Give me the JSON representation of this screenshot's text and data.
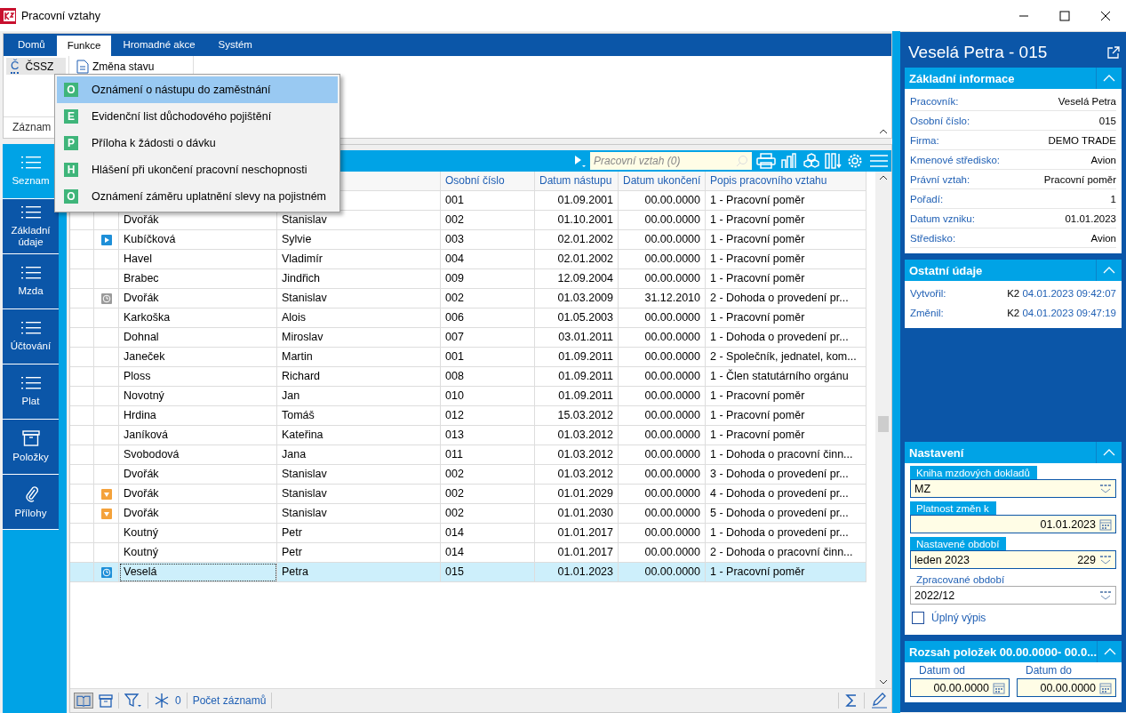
{
  "window": {
    "title": "Pracovní vztahy"
  },
  "ribbon": {
    "tabs": [
      {
        "label": "Domů",
        "selected": false
      },
      {
        "label": "Funkce",
        "selected": true
      },
      {
        "label": "Hromadné akce",
        "selected": false
      },
      {
        "label": "Systém",
        "selected": false
      }
    ],
    "buttons": [
      {
        "kind": "letter",
        "icon_letter": "Č",
        "label": "ČSSZ",
        "pressed": true
      },
      {
        "kind": "doc",
        "label": "Změna stavu",
        "pressed": false
      }
    ],
    "group_label": "Záznam"
  },
  "menu": {
    "items": [
      {
        "letter": "O",
        "label": "Oznámení o nástupu do zaměstnání",
        "selected": true
      },
      {
        "letter": "E",
        "label": "Evidenční list důchodového pojištění",
        "selected": false
      },
      {
        "letter": "P",
        "label": "Příloha k žádosti o dávku",
        "selected": false
      },
      {
        "letter": "H",
        "label": "Hlášení při ukončení pracovní neschopnosti",
        "selected": false
      },
      {
        "letter": "O",
        "label": "Oznámení záměru uplatnění slevy na pojistném",
        "selected": false
      }
    ]
  },
  "sidebar": {
    "items": [
      {
        "kind": "list",
        "label": "Seznam",
        "selected": true
      },
      {
        "kind": "list",
        "label": "Základní údaje",
        "selected": false
      },
      {
        "kind": "list",
        "label": "Mzda",
        "selected": false
      },
      {
        "kind": "list",
        "label": "Účtování",
        "selected": false
      },
      {
        "kind": "list",
        "label": "Plat",
        "selected": false
      },
      {
        "kind": "box",
        "label": "Položky",
        "selected": false
      },
      {
        "kind": "clip",
        "label": "Přílohy",
        "selected": false
      }
    ]
  },
  "table": {
    "search": {
      "placeholder": "Pracovní vztah (0)"
    },
    "columns": [
      "Osobní číslo",
      "Datum nástupu",
      "Datum ukončení",
      "Popis pracovního vztahu"
    ],
    "rows": [
      {
        "number": "001",
        "start": "01.09.2001",
        "end": "00.00.0000",
        "description": "1 - Pracovní poměr",
        "selected": false
      },
      {
        "surname": "Dvořák",
        "name": "Stanislav",
        "number": "002",
        "start": "01.10.2001",
        "end": "00.00.0000",
        "description": "1 - Pracovní poměr",
        "selected": false
      },
      {
        "kind": "play",
        "surname": "Kubíčková",
        "name": "Sylvie",
        "number": "003",
        "start": "02.01.2002",
        "end": "00.00.0000",
        "description": "1 - Pracovní poměr",
        "selected": false
      },
      {
        "surname": "Havel",
        "name": "Vladimír",
        "number": "004",
        "start": "02.01.2002",
        "end": "00.00.0000",
        "description": "1 - Pracovní poměr",
        "selected": false
      },
      {
        "surname": "Brabec",
        "name": "Jindřich",
        "number": "009",
        "start": "12.09.2004",
        "end": "00.00.0000",
        "description": "1 - Pracovní poměr",
        "selected": false
      },
      {
        "kind": "clock",
        "surname": "Dvořák",
        "name": "Stanislav",
        "number": "002",
        "start": "01.03.2009",
        "end": "31.12.2010",
        "description": "2 - Dohoda o provedení pr...",
        "selected": false
      },
      {
        "surname": "Karkoška",
        "name": "Alois",
        "number": "006",
        "start": "01.05.2003",
        "end": "00.00.0000",
        "description": "1 - Pracovní poměr",
        "selected": false
      },
      {
        "surname": "Dohnal",
        "name": "Miroslav",
        "number": "007",
        "start": "03.01.2011",
        "end": "00.00.0000",
        "description": "1 - Dohoda o provedení pr...",
        "selected": false
      },
      {
        "surname": "Janeček",
        "name": "Martin",
        "number": "001",
        "start": "01.09.2011",
        "end": "00.00.0000",
        "description": "2 - Společník, jednatel, kom...",
        "selected": false
      },
      {
        "surname": "Ploss",
        "name": "Richard",
        "number": "008",
        "start": "01.09.2011",
        "end": "00.00.0000",
        "description": "1 - Člen statutárního orgánu",
        "selected": false
      },
      {
        "surname": "Novotný",
        "name": "Jan",
        "number": "010",
        "start": "01.09.2011",
        "end": "00.00.0000",
        "description": "1 - Pracovní poměr",
        "selected": false
      },
      {
        "surname": "Hrdina",
        "name": "Tomáš",
        "number": "012",
        "start": "15.03.2012",
        "end": "00.00.0000",
        "description": "1 - Pracovní poměr",
        "selected": false
      },
      {
        "surname": "Janíková",
        "name": "Kateřina",
        "number": "013",
        "start": "01.03.2012",
        "end": "00.00.0000",
        "description": "1 - Pracovní poměr",
        "selected": false
      },
      {
        "surname": "Svobodová",
        "name": "Jana",
        "number": "011",
        "start": "01.03.2012",
        "end": "00.00.0000",
        "description": "1 - Dohoda o pracovní činn...",
        "selected": false
      },
      {
        "surname": "Dvořák",
        "name": "Stanislav",
        "number": "002",
        "start": "01.03.2012",
        "end": "00.00.0000",
        "description": "3 - Dohoda o provedení pr...",
        "selected": false
      },
      {
        "kind": "down",
        "surname": "Dvořák",
        "name": "Stanislav",
        "number": "002",
        "start": "01.01.2029",
        "end": "00.00.0000",
        "description": "4 - Dohoda o provedení pr...",
        "selected": false
      },
      {
        "kind": "down",
        "surname": "Dvořák",
        "name": "Stanislav",
        "number": "002",
        "start": "01.01.2030",
        "end": "00.00.0000",
        "description": "5 - Dohoda o provedení pr...",
        "selected": false
      },
      {
        "surname": "Koutný",
        "name": "Petr",
        "number": "014",
        "start": "01.01.2017",
        "end": "00.00.0000",
        "description": "1 - Dohoda o provedení pr...",
        "selected": false
      },
      {
        "surname": "Koutný",
        "name": "Petr",
        "number": "014",
        "start": "01.01.2017",
        "end": "00.00.0000",
        "description": "2 - Dohoda o pracovní činn...",
        "selected": false
      },
      {
        "kind": "current",
        "surname": "Veselá",
        "name": "Petra",
        "number": "015",
        "start": "01.01.2023",
        "end": "00.00.0000",
        "description": "1 - Pracovní poměr",
        "selected": true
      }
    ],
    "footer": {
      "count": "0",
      "label": "Počet záznamů"
    }
  },
  "detail": {
    "title": "Veselá Petra - 015",
    "basic": {
      "title": "Základní informace",
      "fields": [
        {
          "label": "Pracovník:",
          "value": "Veselá Petra"
        },
        {
          "label": "Osobní číslo:",
          "value": "015"
        },
        {
          "label": "Firma:",
          "value": "DEMO TRADE"
        },
        {
          "label": "Kmenové středisko:",
          "value": "Avion"
        },
        {
          "label": "Právní vztah:",
          "value": "Pracovní poměr"
        },
        {
          "label": "Pořadí:",
          "value": "1"
        },
        {
          "label": "Datum vzniku:",
          "value": "01.01.2023"
        },
        {
          "label": "Středisko:",
          "value": "Avion"
        }
      ]
    },
    "other": {
      "title": "Ostatní údaje",
      "fields": [
        {
          "label": "Vytvořil:",
          "user": "K2",
          "value": "04.01.2023 09:42:07"
        },
        {
          "label": "Změnil:",
          "user": "K2",
          "value": "04.01.2023 09:47:19"
        }
      ]
    },
    "settings": {
      "title": "Nastavení",
      "fields": [
        {
          "kind": "combo",
          "label": "Kniha mzdových dokladů",
          "value": "MZ",
          "editable": true
        },
        {
          "kind": "date",
          "label": "Platnost změn k",
          "value": "01.01.2023",
          "editable": true
        },
        {
          "kind": "combo",
          "label": "Nastavené období",
          "value": "leden 2023",
          "extra": "229",
          "editable": true
        },
        {
          "kind": "combo",
          "label": "Zpracované období",
          "value": "2022/12",
          "editable": false
        }
      ],
      "checkbox": {
        "label": "Úplný výpis",
        "checked": false
      }
    },
    "range": {
      "title": "Rozsah položek 00.00.0000- 00.0...",
      "fields": [
        {
          "label": "Datum od",
          "value": "00.00.0000"
        },
        {
          "label": "Datum do",
          "value": "00.00.0000"
        }
      ]
    }
  }
}
